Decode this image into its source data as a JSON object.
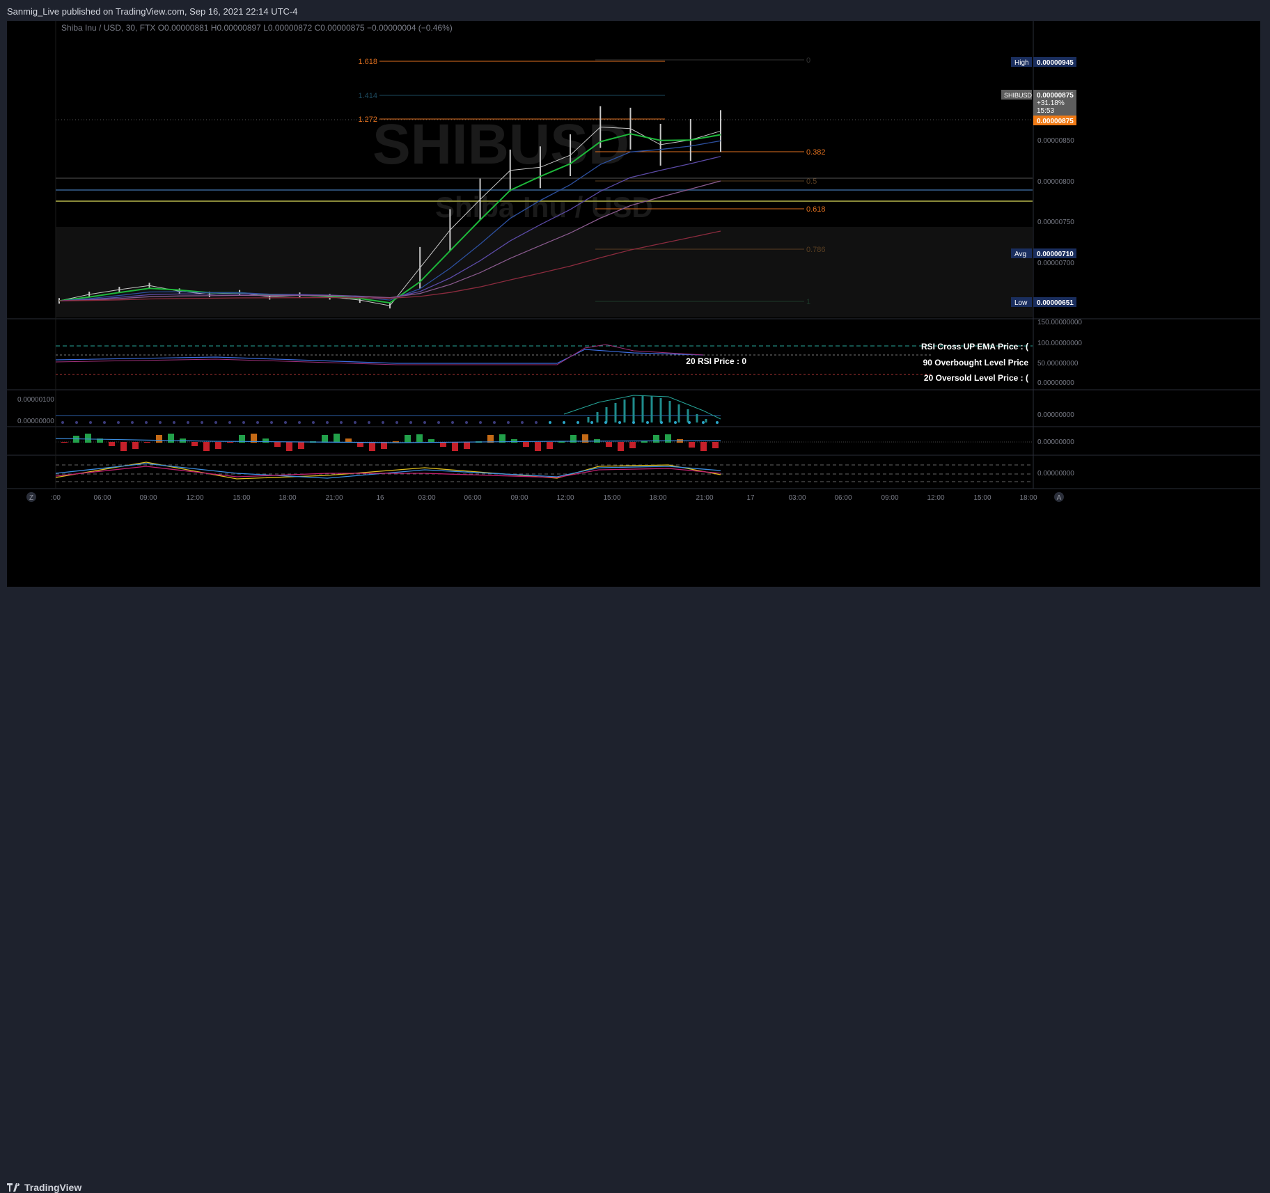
{
  "header": {
    "publish_line": "Sanmig_Live published on TradingView.com, Sep 16, 2021 22:14 UTC-4"
  },
  "footer": {
    "brand": "TradingView"
  },
  "symbol_legend": "Shiba Inu / USD, 30, FTX  O0.00000881  H0.00000897  L0.00000872  C0.00000875  −0.00000004 (−0.46%)",
  "watermark": {
    "ticker": "SHIBUSD",
    "name": "Shiba Inu / USD"
  },
  "colors": {
    "fib": "#e0701f",
    "up": "#c8c8c8",
    "ema1": "#1db83a",
    "ema2": "#2c4f9e",
    "ema3": "#5b4aa6",
    "ema4": "#8a5a8e",
    "ema5": "#8b2b3e",
    "price_tag": "#f07b16",
    "axis_tag": "#1a2e5e",
    "rsi_dash": "#26a69a"
  },
  "price_axis": {
    "ticks": [
      "0.00000850",
      "0.00000800",
      "0.00000750",
      "0.00000700"
    ],
    "high_label": "High",
    "high_value": "0.00000945",
    "symbol_label": "SHIBUSD",
    "symbol_value": "0.00000875",
    "symbol_change": "+31.18%",
    "symbol_countdown": "15:53",
    "last_value": "0.00000875",
    "avg_label": "Avg",
    "avg_value": "0.00000710",
    "low_label": "Low",
    "low_value": "0.00000651"
  },
  "fib_levels": [
    {
      "label": "1.618",
      "side": "left"
    },
    {
      "label": "1.414",
      "side": "left"
    },
    {
      "label": "1.272",
      "side": "left"
    },
    {
      "label": "0",
      "side": "right"
    },
    {
      "label": "0.382",
      "side": "right"
    },
    {
      "label": "0.5",
      "side": "right"
    },
    {
      "label": "0.618",
      "side": "right"
    },
    {
      "label": "0.786",
      "side": "right"
    },
    {
      "label": "1",
      "side": "right"
    }
  ],
  "rsi_pane": {
    "axis": [
      "150.00000000",
      "100.00000000",
      "50.00000000",
      "0.00000000"
    ],
    "labels": [
      "RSI Cross UP EMA Price : (",
      "20 RSI Price : 0",
      "90 Overbought Level Price",
      "20 Oversold Level Price : ("
    ]
  },
  "pane3": {
    "left_ticks": [
      "0.00000100",
      "0.00000000"
    ],
    "axis": "0.00000000"
  },
  "pane4": {
    "axis": "0.00000000"
  },
  "pane5": {
    "axis": "0.00000000"
  },
  "time_axis": {
    "labels": [
      ":00",
      "06:00",
      "09:00",
      "12:00",
      "15:00",
      "18:00",
      "21:00",
      "16",
      "03:00",
      "06:00",
      "09:00",
      "12:00",
      "15:00",
      "18:00",
      "21:00",
      "17",
      "03:00",
      "06:00",
      "09:00",
      "12:00",
      "15:00",
      "18:00"
    ],
    "left_btn": "Z",
    "right_btn": "A"
  },
  "chart_data": {
    "type": "line",
    "title": "Shiba Inu / USD, 30, FTX",
    "x": [
      "09-15 03:00",
      "09-15 06:00",
      "09-15 09:00",
      "09-15 12:00",
      "09-15 15:00",
      "09-15 18:00",
      "09-15 21:00",
      "09-16 00:00",
      "09-16 03:00",
      "09-16 06:00",
      "09-16 09:00",
      "09-16 11:00",
      "09-16 12:00",
      "09-16 13:00",
      "09-16 14:00",
      "09-16 15:00",
      "09-16 16:00",
      "09-16 17:00",
      "09-16 18:00",
      "09-16 19:00",
      "09-16 20:00",
      "09-16 21:00",
      "09-16 22:00"
    ],
    "series": [
      {
        "name": "SHIBUSD",
        "values": [
          6.64e-06,
          6.72e-06,
          6.78e-06,
          6.83e-06,
          6.76e-06,
          6.72e-06,
          6.74e-06,
          6.69e-06,
          6.71e-06,
          6.69e-06,
          6.65e-06,
          6.58e-06,
          7.05e-06,
          7.52e-06,
          7.9e-06,
          8.26e-06,
          8.3e-06,
          8.45e-06,
          8.8e-06,
          8.78e-06,
          8.58e-06,
          8.64e-06,
          8.75e-06
        ]
      }
    ],
    "ylim": [
      6.4e-06,
      9.6e-06
    ],
    "high": 9.45e-06,
    "low": 6.51e-06,
    "avg": 7.1e-06
  }
}
